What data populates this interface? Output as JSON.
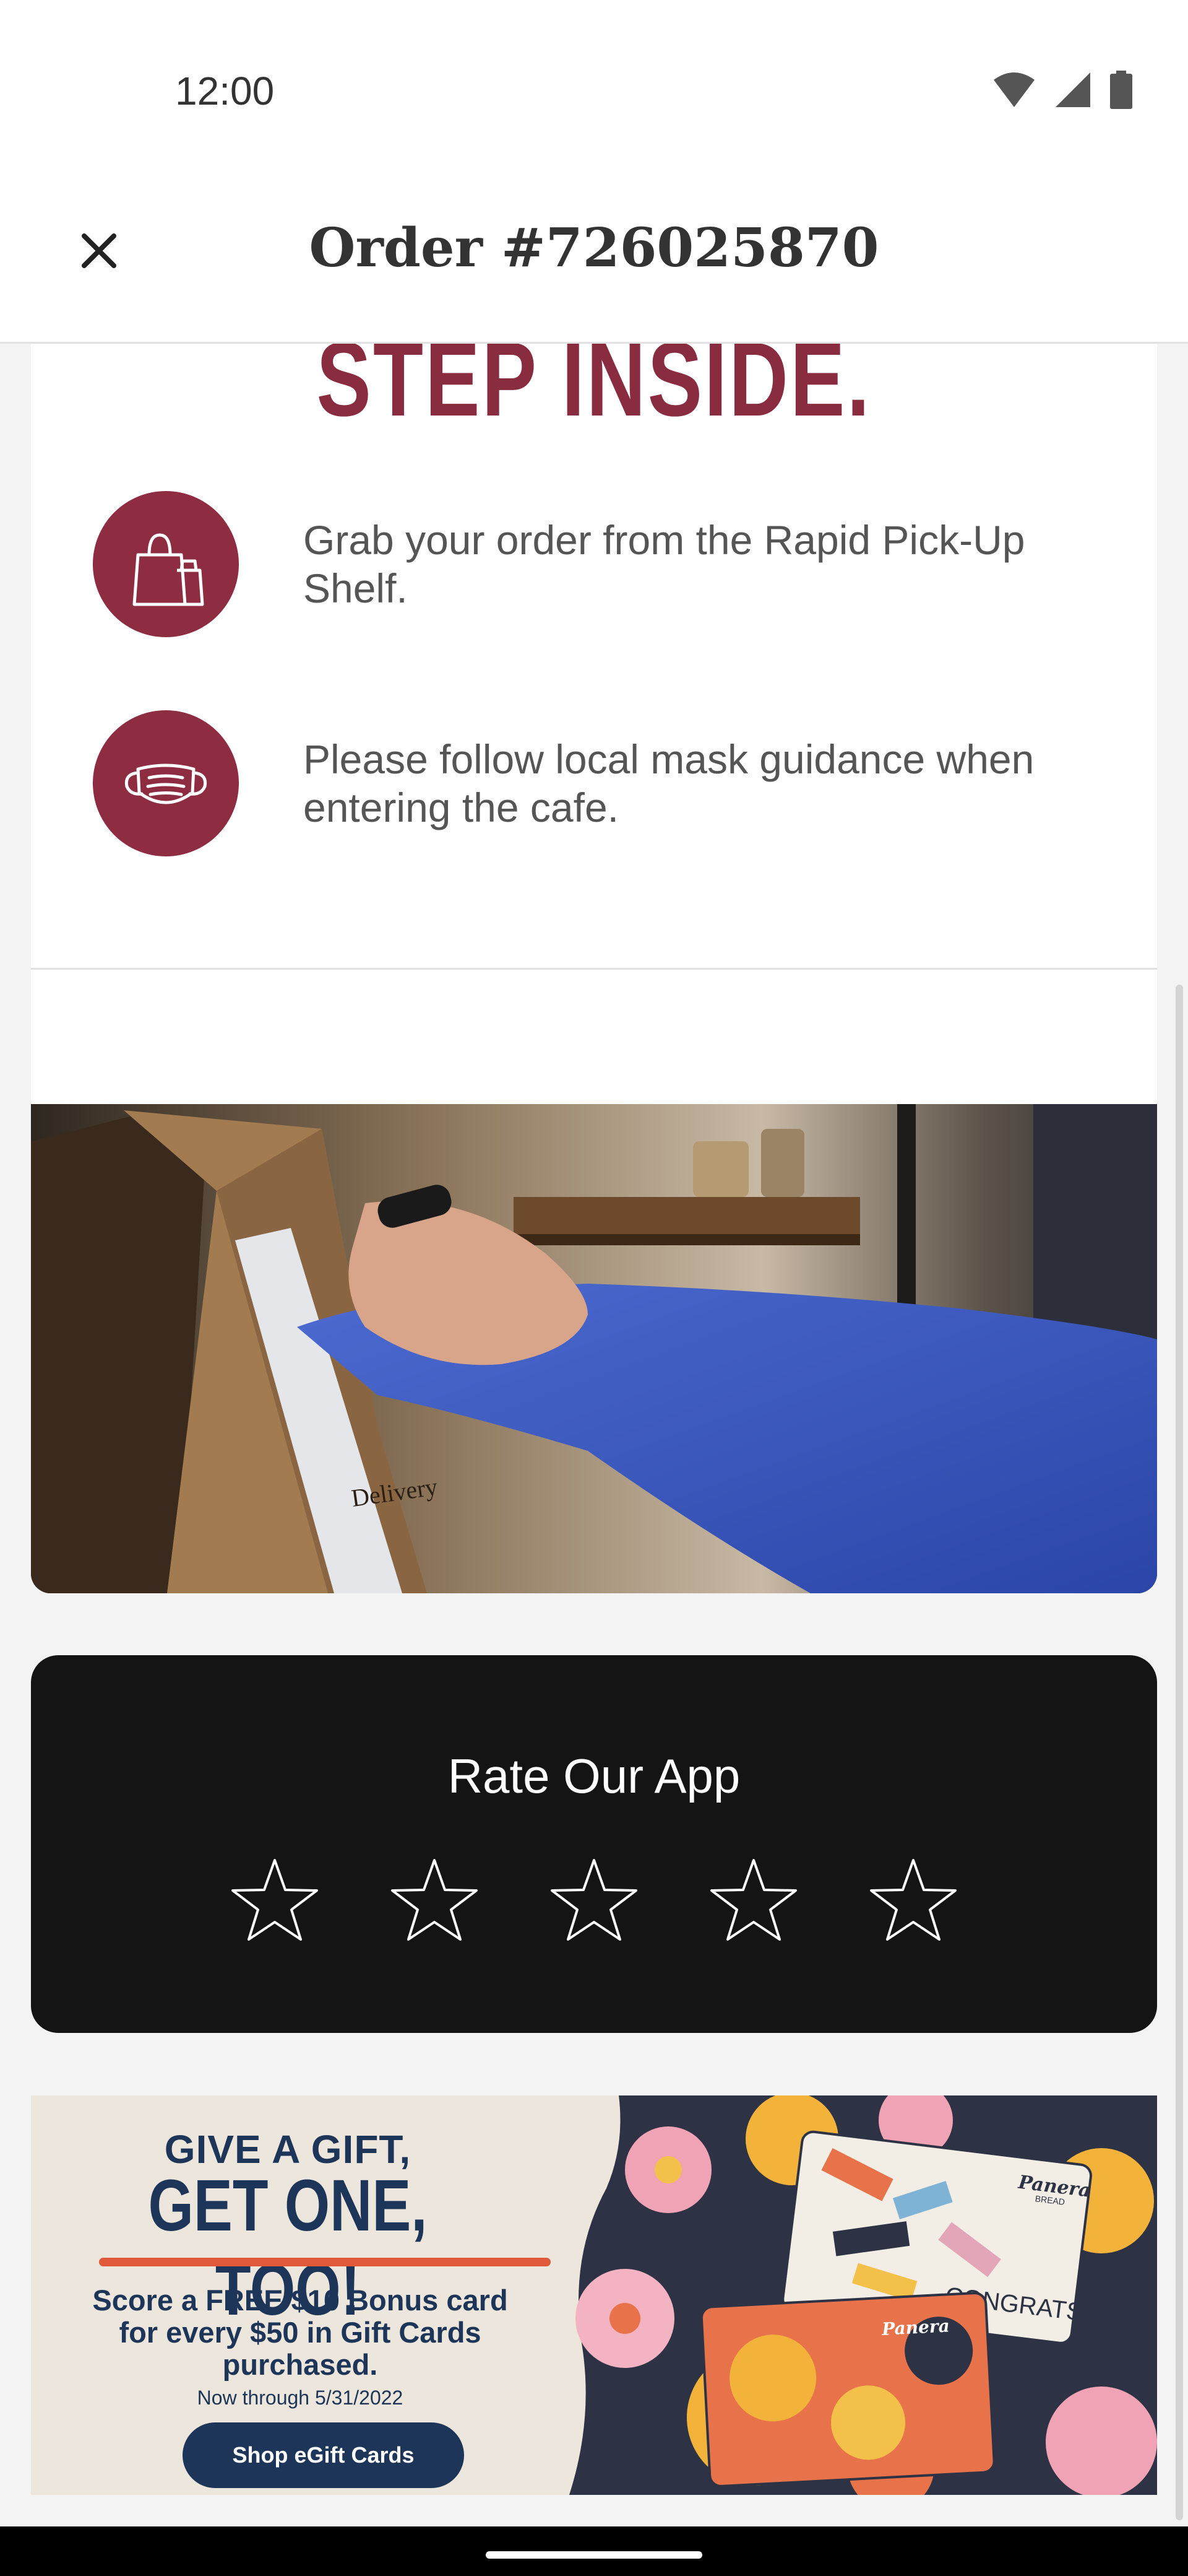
{
  "status_bar": {
    "time": "12:00"
  },
  "header": {
    "title": "Order #726025870",
    "close_icon": "close-icon"
  },
  "steps_card": {
    "title": "STEP INSIDE.",
    "steps": [
      {
        "icon": "shopping-bags-icon",
        "text": "Grab your order from the Rapid Pick-Up Shelf."
      },
      {
        "icon": "face-mask-icon",
        "text": "Please follow local mask guidance when entering the cafe."
      }
    ],
    "accent_color": "#8e2c42"
  },
  "photo": {
    "bag_text": "Delivery"
  },
  "rate_app": {
    "title": "Rate Our App",
    "rating": 0,
    "max_rating": 5
  },
  "promo": {
    "kicker": "GIVE A GIFT,",
    "headline": "GET ONE, TOO!",
    "body": "Score a FREE $10 Bonus card for every $50 in Gift Cards purchased.",
    "date": "Now through 5/31/2022",
    "button_label": "Shop eGift Cards",
    "card_brand": "Panera",
    "card_sub": "BREAD",
    "card_message": "CONGRATS!"
  },
  "colors": {
    "brand": "#8e2c42",
    "navy": "#1d3558",
    "orange": "#e05a3a",
    "dark_card": "#141414"
  }
}
